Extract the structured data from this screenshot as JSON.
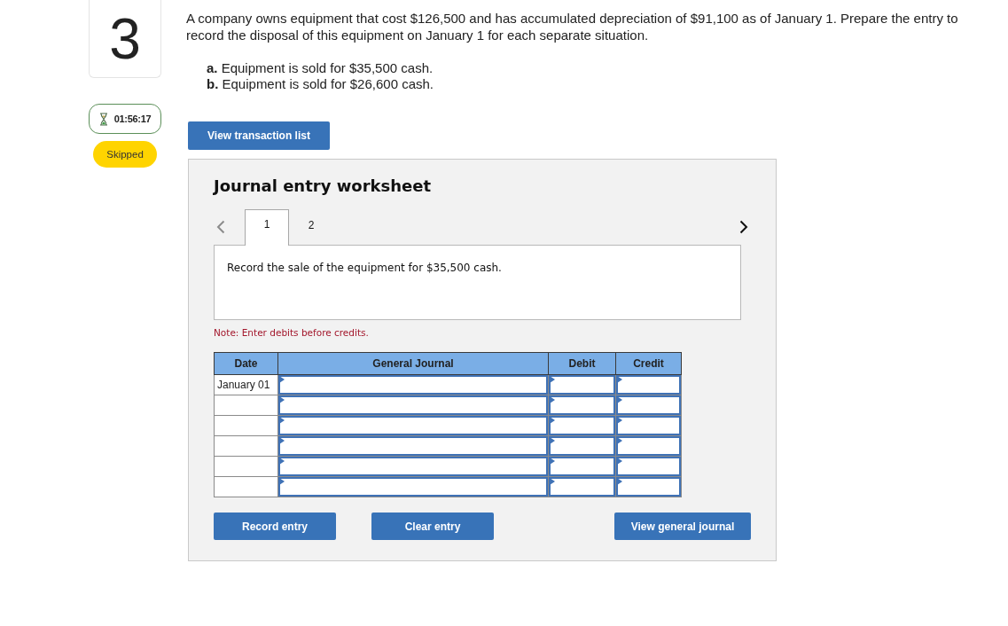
{
  "question": {
    "number": "3",
    "timer": "01:56:17",
    "status": "Skipped",
    "prompt": "A company owns equipment that cost $126,500 and has accumulated depreciation of $91,100 as of January 1. Prepare the entry to record the disposal of this equipment on January 1 for each separate situation.",
    "parts": [
      "**a.** Equipment is sold for $35,500 cash.",
      "**b.** Equipment is sold for $26,600 cash."
    ]
  },
  "transaction_button": "View transaction list",
  "worksheet": {
    "title": "Journal entry worksheet",
    "nav": [
      {
        "kind": "prev",
        "disabled": true
      },
      {
        "kind": "next",
        "disabled": false
      }
    ],
    "tabs": [
      {
        "label": "1",
        "selected": true
      },
      {
        "label": "2",
        "selected": false
      }
    ],
    "instruction": "Record the sale of the equipment for $35,500 cash.",
    "note": "Note: Enter debits before credits.",
    "table": {
      "columns": [
        "Date",
        "General Journal",
        "Debit",
        "Credit"
      ],
      "rows": [
        {
          "date": "January 01"
        },
        {},
        {},
        {},
        {},
        {}
      ]
    },
    "buttons": [
      "Record entry",
      "Clear entry",
      "View general journal"
    ]
  }
}
